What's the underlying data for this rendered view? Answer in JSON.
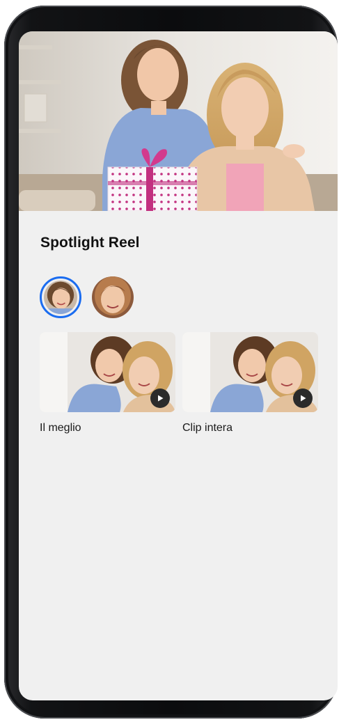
{
  "section": {
    "title": "Spotlight Reel"
  },
  "faces": [
    {
      "icon": "person-face-girl",
      "selected": true
    },
    {
      "icon": "person-face-woman",
      "selected": false
    }
  ],
  "clips": [
    {
      "label": "Il meglio",
      "icon": "play-icon"
    },
    {
      "label": "Clip intera",
      "icon": "play-icon"
    }
  ],
  "colors": {
    "accent": "#1a6cf0",
    "background": "#f0f0f0",
    "text": "#111111"
  }
}
